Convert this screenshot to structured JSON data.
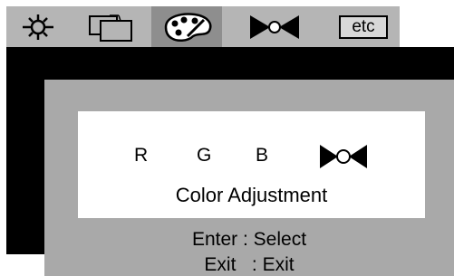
{
  "tabs": [
    {
      "icon": "brightness-icon",
      "selected": false
    },
    {
      "icon": "windows-icon",
      "selected": false
    },
    {
      "icon": "palette-icon",
      "selected": true
    },
    {
      "icon": "bowtie-icon",
      "selected": false
    },
    {
      "icon": "etc-icon",
      "label": "etc",
      "selected": false
    }
  ],
  "panel": {
    "channels": [
      "R",
      "G",
      "B"
    ],
    "selected_icon": "bowtie-icon",
    "title": "Color Adjustment",
    "help": {
      "enter_line": "Enter : Select",
      "exit_line": "Exit   : Exit"
    }
  },
  "colors": {
    "topbar": "#b5b5b5",
    "tab_selected": "#8e8e8e",
    "panel": "#a9a9a9",
    "background": "#000000"
  }
}
